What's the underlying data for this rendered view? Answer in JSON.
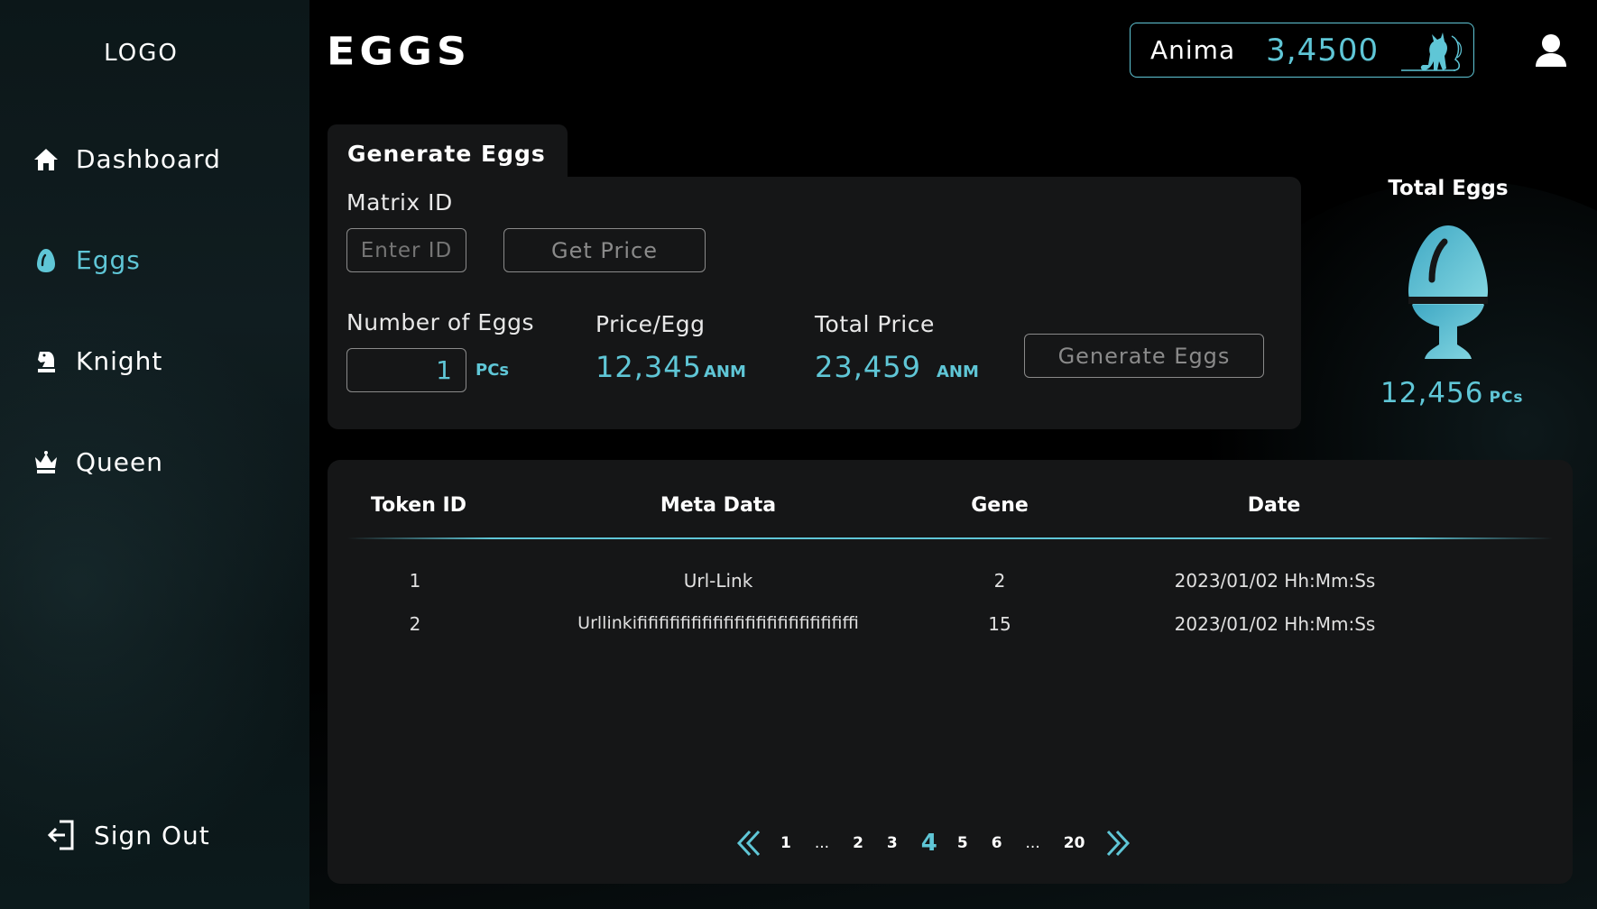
{
  "sidebar": {
    "logo": "LOGO",
    "items": [
      {
        "label": "Dashboard",
        "icon": "home-icon"
      },
      {
        "label": "Eggs",
        "icon": "egg-icon",
        "active": true
      },
      {
        "label": "Knight",
        "icon": "knight-icon"
      },
      {
        "label": "Queen",
        "icon": "crown-icon"
      }
    ],
    "sign_out": "Sign Out"
  },
  "header": {
    "title": "EGGS",
    "balance_label": "Anima",
    "balance_value": "3,4500",
    "balance_icon": "cat-icon",
    "user_icon": "user-icon"
  },
  "generate": {
    "tab_label": "Generate Eggs",
    "matrix_id_label": "Matrix ID",
    "matrix_id_placeholder": "Enter ID",
    "get_price_label": "Get Price",
    "num_eggs_label": "Number of Eggs",
    "num_eggs_value": "1",
    "num_eggs_unit": "PCs",
    "price_per_egg_label": "Price/Egg",
    "price_per_egg_value": "12,345",
    "price_unit": "ANM",
    "total_price_label": "Total Price",
    "total_price_value": "23,459",
    "total_price_unit": "ANM",
    "generate_button_label": "Generate Eggs"
  },
  "total_eggs": {
    "title": "Total Eggs",
    "value": "12,456",
    "unit": "PCs"
  },
  "table": {
    "columns": [
      "Token ID",
      "Meta Data",
      "Gene",
      "Date"
    ],
    "rows": [
      [
        "1",
        "Url-Link",
        "2",
        "2023/01/02 Hh:Mm:Ss"
      ],
      [
        "2",
        "Urllinkififififififififififififififififififififfi",
        "15",
        "2023/01/02 Hh:Mm:Ss"
      ]
    ]
  },
  "pagination": {
    "pages": [
      "1",
      "...",
      "2",
      "3",
      "4",
      "5",
      "6",
      "...",
      "20"
    ],
    "current": "4"
  },
  "colors": {
    "accent": "#5fc6d6",
    "panel": "#151617",
    "background": "#000000",
    "sidebar": "#0f1b1d"
  }
}
